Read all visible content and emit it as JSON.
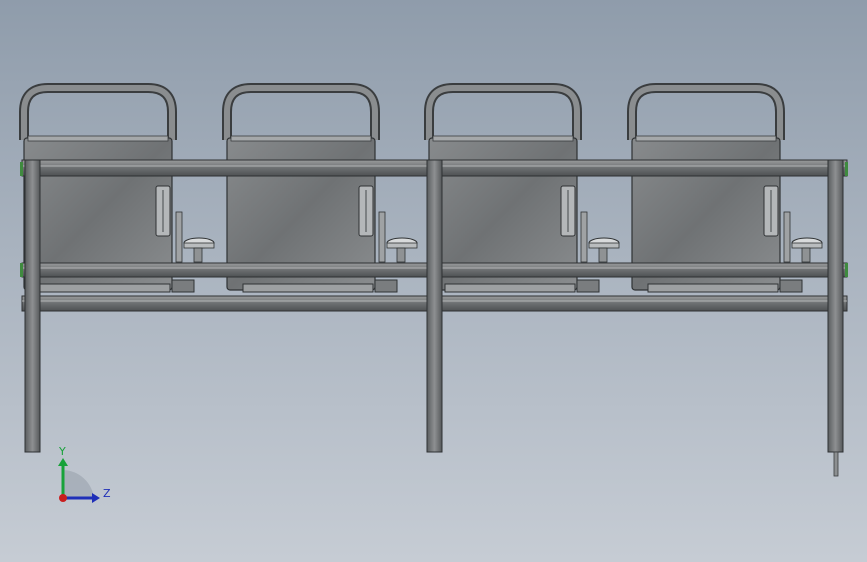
{
  "viewport": {
    "background_top": "#8f9cab",
    "background_bottom": "#c6ccd4"
  },
  "model": {
    "seat_count": 4,
    "frame_color": "#6e7173",
    "seat_color": "#7d8082"
  },
  "triad": {
    "y_label": "Y",
    "z_label": "Z",
    "y_color": "#18a23a",
    "z_color": "#1f2fb8",
    "x_color": "#c81e1e"
  }
}
